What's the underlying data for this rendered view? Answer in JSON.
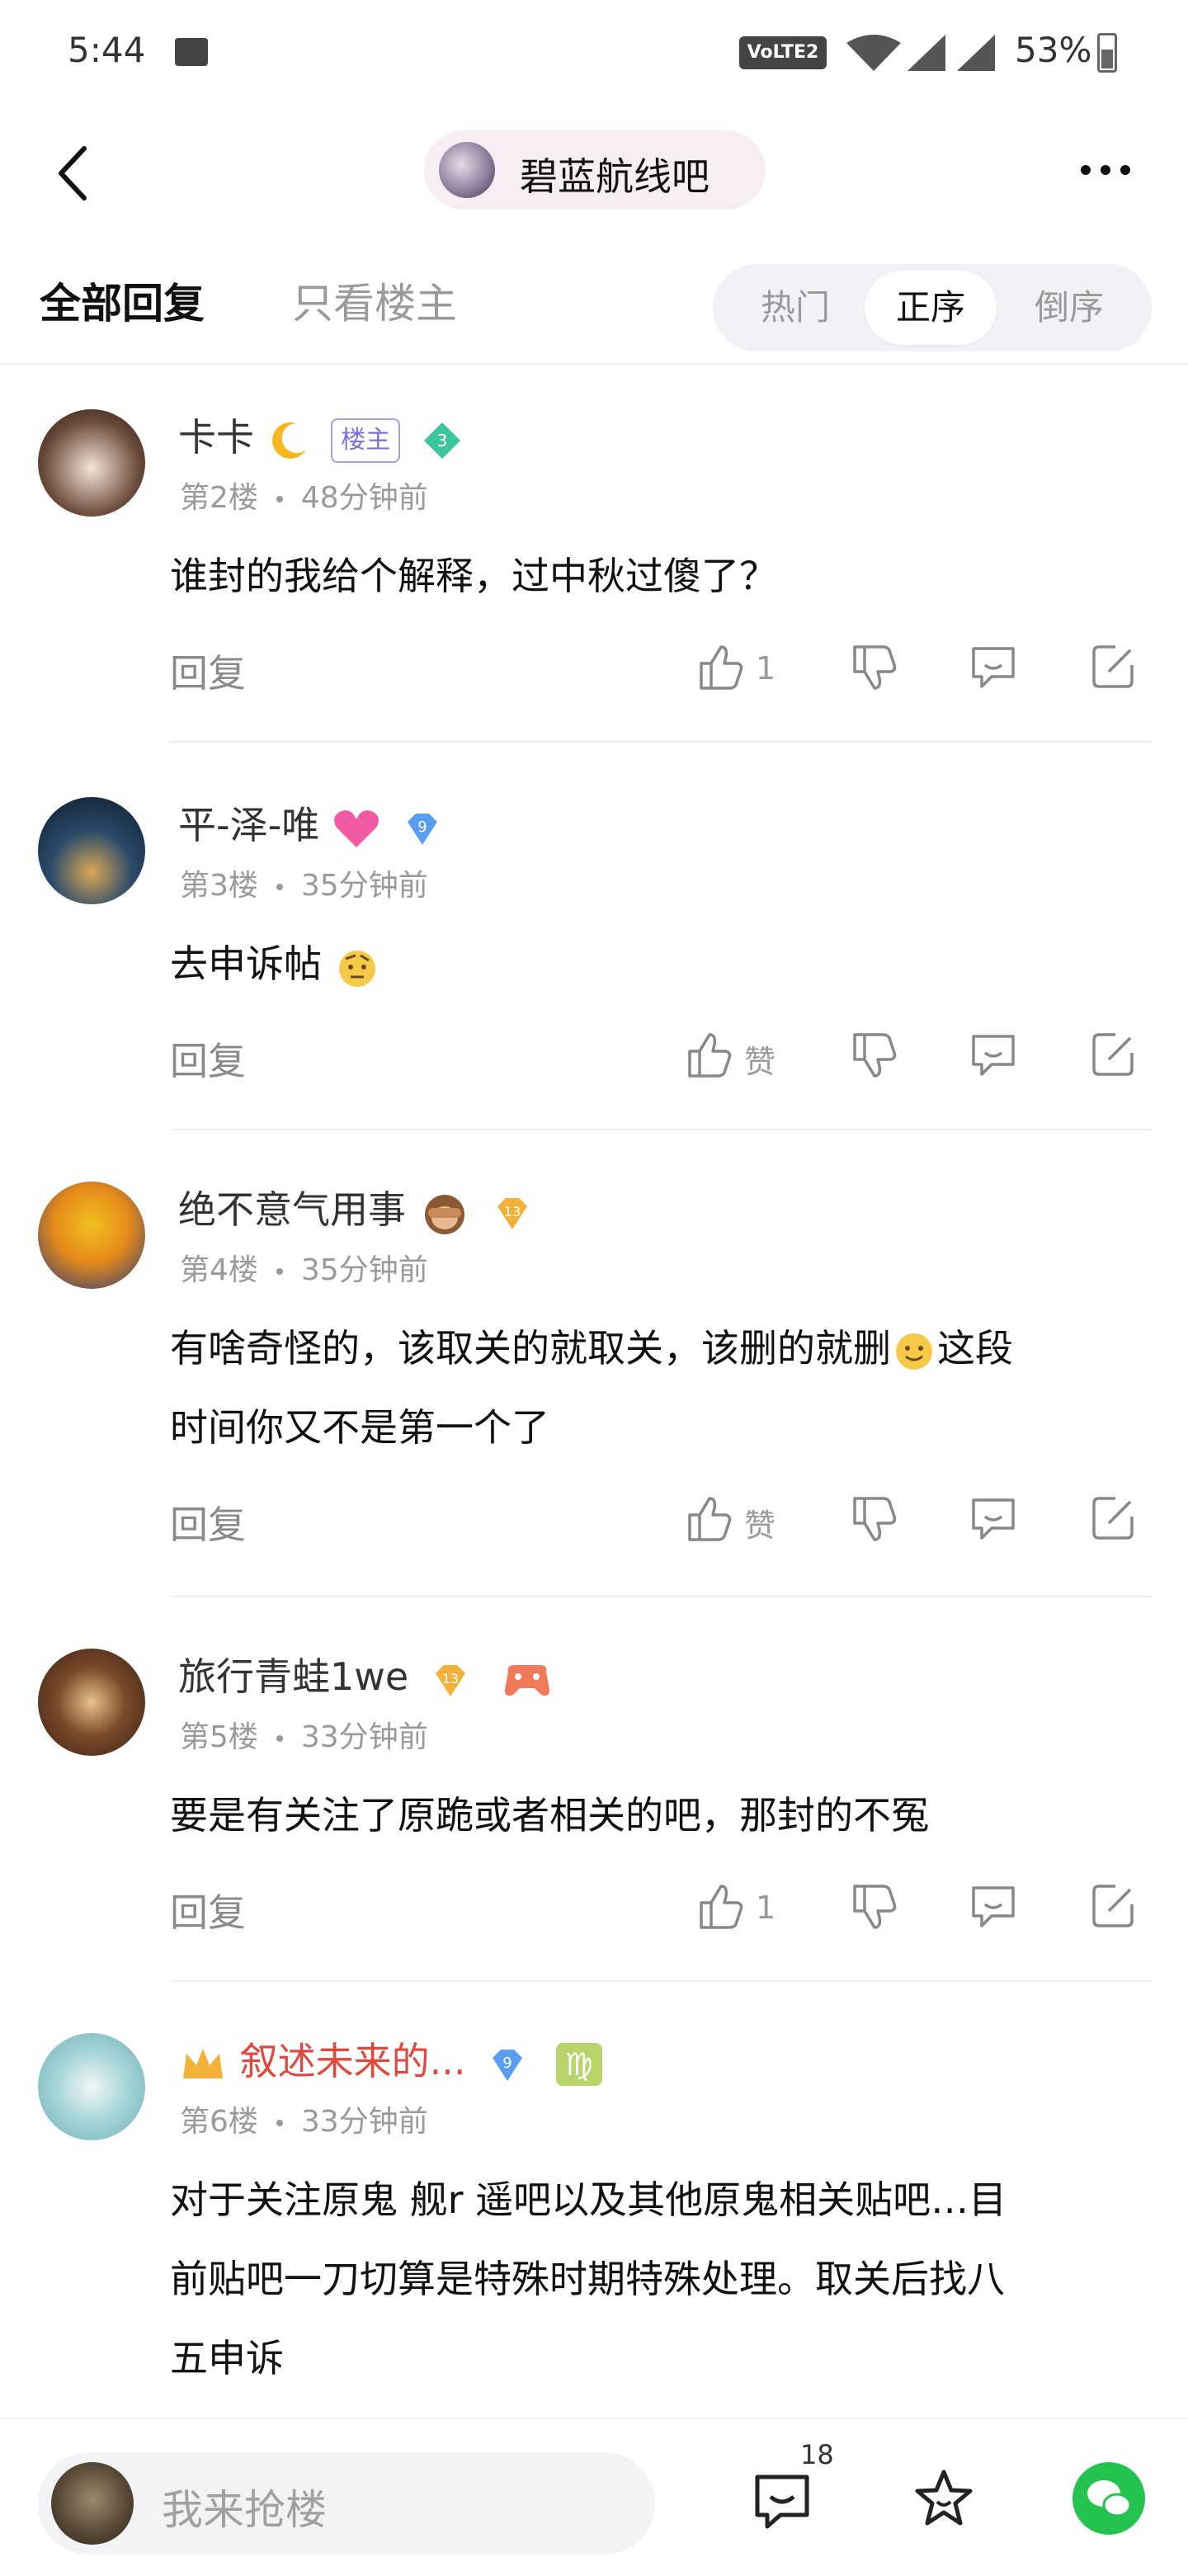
{
  "status_bar": {
    "time": "5:44",
    "network": "VoLTE2",
    "battery": "53%"
  },
  "header": {
    "forum_name": "碧蓝航线吧"
  },
  "tabs": {
    "all_replies": "全部回复",
    "op_only": "只看楼主",
    "sort": [
      "热门",
      "正序",
      "倒序"
    ],
    "active_sort": "正序"
  },
  "posts": [
    {
      "username": "卡卡",
      "is_op": true,
      "op_label": "楼主",
      "level": "3",
      "floor": "第2楼",
      "time": "48分钟前",
      "content": "谁封的我给个解释，过中秋过傻了？",
      "reply_label": "回复",
      "likes": "1"
    },
    {
      "username": "平-泽-唯",
      "level": "9",
      "floor": "第3楼",
      "time": "35分钟前",
      "content": "去申诉帖",
      "reply_label": "回复",
      "likes": "赞"
    },
    {
      "username": "绝不意气用事",
      "level": "13",
      "floor": "第4楼",
      "time": "35分钟前",
      "content_line1": "有啥奇怪的，该取关的就取关，该删的就删",
      "content_line1b": "这段",
      "content_line2": "时间你又不是第一个了",
      "reply_label": "回复",
      "likes": "赞"
    },
    {
      "username": "旅行青蛙1we",
      "level": "13",
      "floor": "第5楼",
      "time": "33分钟前",
      "content": "要是有关注了原跪或者相关的吧，那封的不冤",
      "reply_label": "回复",
      "likes": "1"
    },
    {
      "username": "叙述未来的...",
      "level": "9",
      "zodiac": "♍",
      "floor": "第6楼",
      "time": "33分钟前",
      "content_line1": "对于关注原鬼 舰r 遥吧以及其他原鬼相关贴吧…目",
      "content_line2": "前贴吧一刀切算是特殊时期特殊处理。取关后找八",
      "content_line3": "五申诉"
    }
  ],
  "bottom_bar": {
    "placeholder": "我来抢楼",
    "comment_count": "18"
  },
  "colors": {
    "accent_green": "#24c24f",
    "vip_name_red": "#e0483d",
    "op_badge": "#7c73d9"
  }
}
